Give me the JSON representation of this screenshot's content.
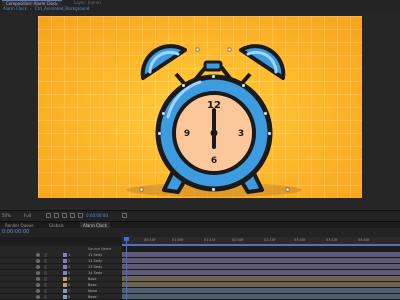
{
  "window": {
    "tab_active": "Composition: Alarm Clock",
    "tab_other": "Layer: (none)"
  },
  "breadcrumbs": [
    "Alarm Clock",
    "Ctrl_Animated_Background"
  ],
  "viewer": {
    "zoom": "50%",
    "resolution": "Full",
    "timecode": "0:00:00:00"
  },
  "timeline": {
    "tabs": [
      "Render Queue",
      "Globals",
      "Alarm Clock"
    ],
    "current_time": "0:00:00:00",
    "column_header": "Source Name",
    "ruler_ticks": [
      "00:15f",
      "01:00f",
      "01:15f",
      "02:00f",
      "02:15f",
      "03:00f",
      "03:15f",
      "04:00f"
    ],
    "layers": [
      {
        "num": "1",
        "name": "11 Sedy",
        "color": "#8a7cc4"
      },
      {
        "num": "2",
        "name": "12 Sedy",
        "color": "#8a7cc4"
      },
      {
        "num": "3",
        "name": "13 Sedy",
        "color": "#8a7cc4"
      },
      {
        "num": "4",
        "name": "14 Sedy",
        "color": "#8a7cc4"
      },
      {
        "num": "5",
        "name": "Base",
        "color": "#c49e6a"
      },
      {
        "num": "6",
        "name": "Base",
        "color": "#c49e6a"
      },
      {
        "num": "7",
        "name": "None",
        "color": "#7ca0c4"
      },
      {
        "num": "8",
        "name": "Base",
        "color": "#7ca0c4"
      }
    ]
  },
  "clock": {
    "numerals": [
      "12",
      "3",
      "6",
      "9"
    ],
    "background_color": "#fdb528",
    "face_color": "#fcc89b",
    "rim_color": "#3d9be0",
    "outline_color": "#1a1a1a"
  }
}
